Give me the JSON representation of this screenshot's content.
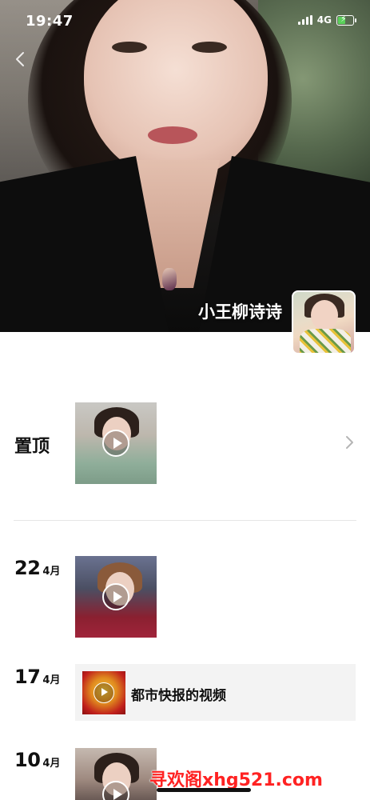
{
  "status_bar": {
    "time": "19:47",
    "network": "4G",
    "icons": [
      "signal-icon",
      "battery-charging-icon"
    ]
  },
  "header": {
    "profile_name": "小王柳诗诗",
    "icons": [
      "back-icon",
      "avatar"
    ]
  },
  "pinned": {
    "label": "置顶",
    "icons": [
      "play-icon",
      "chevron-right-icon"
    ]
  },
  "posts": [
    {
      "day": "22",
      "month": "4月",
      "type": "video"
    },
    {
      "day": "17",
      "month": "4月",
      "type": "shared-video",
      "title": "都市快报的视频"
    },
    {
      "day": "10",
      "month": "4月",
      "type": "video"
    }
  ],
  "watermark": "寻欢阁xhg521.com",
  "colors": {
    "accent_watermark": "#ff2222",
    "shared_card_bg": "#f3f3f3",
    "battery": "#5ad05a"
  }
}
